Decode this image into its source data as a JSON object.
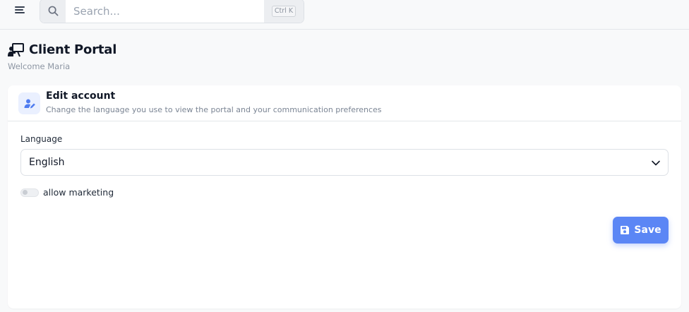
{
  "header": {
    "search_placeholder": "Search...",
    "search_shortcut": "Ctrl K"
  },
  "page": {
    "title": "Client Portal",
    "subtitle": "Welcome Maria"
  },
  "card": {
    "title": "Edit account",
    "description": "Change the language you use to view the portal and your communication preferences",
    "language_label": "Language",
    "language_value": "English",
    "allow_marketing_label": "allow marketing",
    "allow_marketing_on": false,
    "save_label": "Save"
  },
  "colors": {
    "accent": "#5b86f5",
    "icon_bg": "#eaf0ff",
    "page_bg": "#f8f9fa"
  },
  "icons": {
    "menu": "hamburger-icon",
    "search": "search-icon",
    "portal": "presentation-board-icon",
    "edit_account": "user-edit-icon",
    "dropdown": "chevron-down-icon",
    "save": "floppy-disk-icon"
  }
}
